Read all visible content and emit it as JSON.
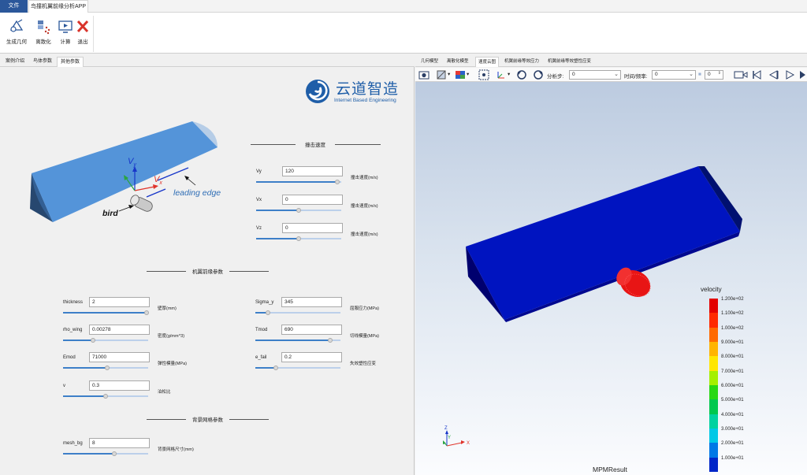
{
  "ribbon": {
    "tabs": [
      "文件",
      "鸟撞机翼前缘分析APP"
    ],
    "buttons": [
      {
        "label": "生成几何",
        "icon": "geometry-icon"
      },
      {
        "label": "离散化",
        "icon": "discretize-icon"
      },
      {
        "label": "计算",
        "icon": "compute-icon"
      },
      {
        "label": "退出",
        "icon": "exit-icon"
      }
    ]
  },
  "left_tabs": [
    "案例介绍",
    "鸟体参数",
    "其他参数"
  ],
  "logo": {
    "cn": "云道智造",
    "en": "Internet Based Engineering"
  },
  "figure": {
    "vy": "V",
    "vy_sub": "y",
    "vx": "V",
    "vx_sub": "x",
    "leading_edge": "leading edge",
    "bird": "bird"
  },
  "impact_section": {
    "title": "撞击速度",
    "params": [
      {
        "label": "Vy",
        "value": "120",
        "desc": "撞击速度(m/s)",
        "pos": 0.95
      },
      {
        "label": "Vx",
        "value": "0",
        "desc": "撞击速度(m/s)",
        "pos": 0.5
      },
      {
        "label": "Vz",
        "value": "0",
        "desc": "撞击速度(m/s)",
        "pos": 0.5
      }
    ]
  },
  "wing_section": {
    "title": "机翼前缘参数",
    "params": [
      {
        "label": "thickness",
        "value": "2",
        "desc": "壁厚(mm)",
        "pos": 0.98
      },
      {
        "label": "rho_wing",
        "value": "0.00278",
        "desc": "密度(g/mm^3)",
        "pos": 0.35
      },
      {
        "label": "Emod",
        "value": "71000",
        "desc": "弹性模量(MPa)",
        "pos": 0.52
      },
      {
        "label": "v",
        "value": "0.3",
        "desc": "泊松比",
        "pos": 0.5
      },
      {
        "label": "Sigma_y",
        "value": "345",
        "desc": "屈服应力(MPa)",
        "pos": 0.15
      },
      {
        "label": "Tmod",
        "value": "690",
        "desc": "切线模量(MPa)",
        "pos": 0.88
      },
      {
        "label": "e_fail",
        "value": "0.2",
        "desc": "失效塑性应变",
        "pos": 0.24
      }
    ]
  },
  "mesh_section": {
    "title": "背景网格参数",
    "params": [
      {
        "label": "mesh_bg",
        "value": "8",
        "desc": "背景网格尺寸(mm)",
        "pos": 0.6
      }
    ]
  },
  "view_tabs": [
    "几何模型",
    "离散化模型",
    "速度云图",
    "机翼前缘等效应力",
    "机翼前缘等效塑性应变"
  ],
  "toolbar": {
    "step_label": "分析步:",
    "step_value": "0",
    "time_label": "时间/频率:",
    "time_value": "0",
    "frame_value": "0"
  },
  "legend": {
    "title": "velocity",
    "labels": [
      "1.200e+02",
      "1.100e+02",
      "1.000e+02",
      "9.000e+01",
      "8.000e+01",
      "7.000e+01",
      "6.000e+01",
      "5.000e+01",
      "4.000e+01",
      "3.000e+01",
      "2.000e+01",
      "1.000e+01"
    ],
    "colors": [
      "#e30000",
      "#ff2a00",
      "#ff6a00",
      "#ffb400",
      "#ffe600",
      "#a4f000",
      "#28d814",
      "#00c84e",
      "#00d2a0",
      "#00c8e6",
      "#0078e6",
      "#0026c8"
    ]
  },
  "axes": {
    "x": "X",
    "y": "Y",
    "z": "Z"
  },
  "viewport_caption": "MPMResult"
}
